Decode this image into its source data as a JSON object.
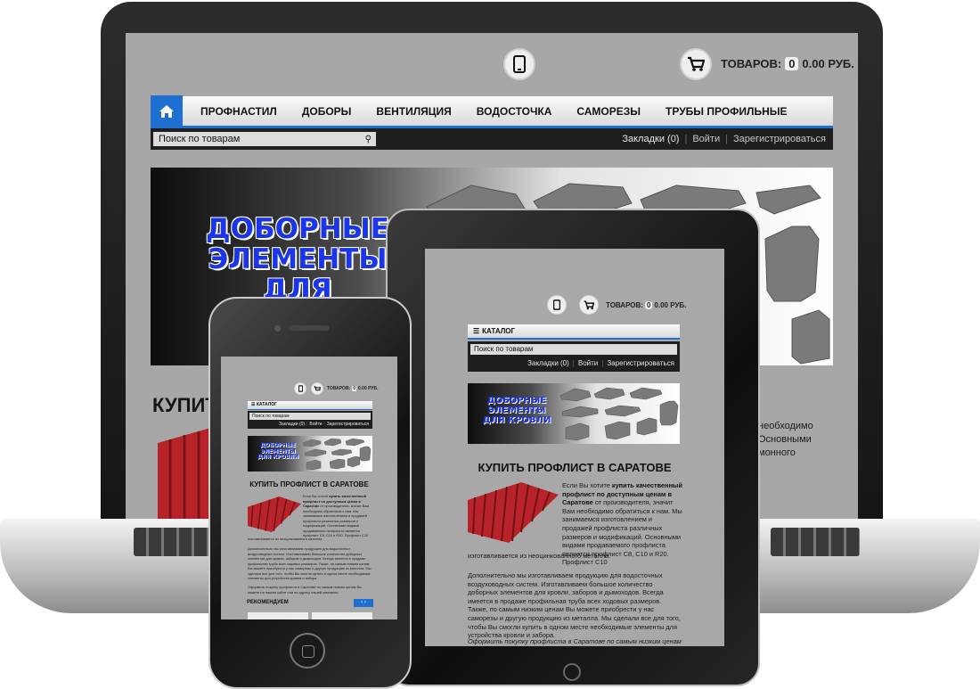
{
  "header": {
    "phone_icon": "smartphone-icon",
    "cart_icon": "cart-icon",
    "cart_label": "ТОВАРОВ:",
    "cart_count": "0",
    "cart_total": "0.00 РУБ."
  },
  "nav": {
    "home_icon": "home-icon",
    "items": [
      "ПРОФНАСТИЛ",
      "ДОБОРЫ",
      "ВЕНТИЛЯЦИЯ",
      "ВОДОСТОЧКА",
      "САМОРЕЗЫ",
      "ТРУБЫ ПРОФИЛЬНЫЕ"
    ],
    "catalog_label": "КАТАЛОГ"
  },
  "search": {
    "placeholder": "Поиск по товарам"
  },
  "account": {
    "bookmarks": "Закладки (0)",
    "login": "Войти",
    "register": "Зарегистрироваться"
  },
  "banner": {
    "line1": "ДОБОРНЫЕ",
    "line2": "ЭЛЕМЕНТЫ",
    "line3": "ДЛЯ КРОВЛИ"
  },
  "laptop_page": {
    "heading_fragment": "КУПИТ",
    "body_fragment_1": "необходимо",
    "body_fragment_2": "Основными",
    "body_fragment_3": "монного"
  },
  "content": {
    "heading": "КУПИТЬ ПРОФЛИСТ В САРАТОВЕ",
    "p1_a": "Если Вы хотите ",
    "p1_b": "купить качественный профлист по доступным ценам в Саратове",
    "p1_c": " от производителя, значит Вам необходимо обратиться к нам. Мы занимаемся изготовлением и продажей профлиста различных размеров и модификаций. Основными видами продаваемого профлиста является профлист С8, С10 и R20. Профлист С10",
    "p1_d": "изготавливается из неоцинкованного металла.",
    "p2": "Дополнительно мы изготавливаем продукцию для водосточных воздуховодных систем. Изготавливаем большое количество доборных элементов для кровли, заборов и дымоходов. Всегда имеется в продаже профильная труба всех ходовых размеров. Также, по самым низким ценам Вы можете приобрести у нас саморезы и другую продукцию из металла. Мы сделали все для того, чтобы Вы смогли купить в одном месте необходимые элементы для устройства кровли и забора.",
    "p3": "Оформить покупку профлиста в Саратове по самым низким ценам Вы можете на нашем сайте или по адресу нашей компании.",
    "recommend": "РЕКОМЕНДУЕМ",
    "arrows": "‹ ›"
  },
  "colors": {
    "accent": "#1d6fd1",
    "banner_text": "#1b35e8",
    "roof_red": "#b8232a",
    "screen_bg": "#a7a7a7",
    "bar": "#1e1e1e"
  }
}
